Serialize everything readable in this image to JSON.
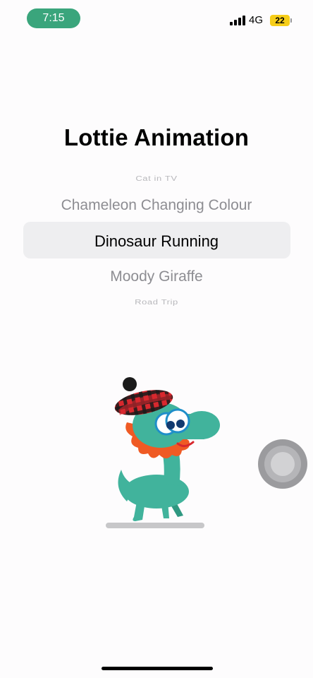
{
  "status_bar": {
    "time": "7:15",
    "network": "4G",
    "battery": "22",
    "time_pill_color": "#3aa57c",
    "battery_color": "#f6cd18"
  },
  "title": "Lottie Animation",
  "picker": {
    "items": [
      "Cat in TV",
      "Chameleon Changing Colour",
      "Dinosaur Running",
      "Moody Giraffe",
      "Road Trip"
    ],
    "selected": "Dinosaur Running"
  },
  "animation": {
    "icon": "dinosaur-running-animation"
  }
}
